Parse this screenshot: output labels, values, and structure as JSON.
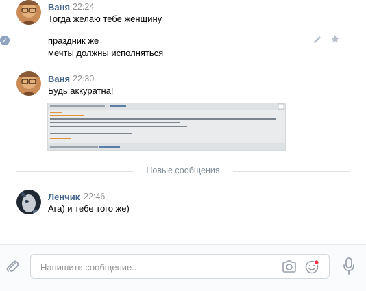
{
  "messages": [
    {
      "author": "Ваня",
      "time": "22:24",
      "lines": [
        "Тогда желаю тебе женщину",
        "праздник же",
        "мечты должны исполняться"
      ]
    },
    {
      "author": "Ваня",
      "time": "22:30",
      "lines": [
        "Будь аккуратна!"
      ]
    },
    {
      "author": "Ленчик",
      "time": "22:46",
      "lines": [
        "Ага) и тебе того же)"
      ]
    }
  ],
  "divider": {
    "label": "Новые сообщения"
  },
  "composer": {
    "placeholder": "Напишите сообщение..."
  },
  "icons": {
    "read_check": "check-circle-icon",
    "edit": "pencil-icon",
    "favorite": "star-icon",
    "attach": "paperclip-icon",
    "camera": "camera-icon",
    "emoji": "smile-icon",
    "voice": "microphone-icon"
  },
  "colors": {
    "author": "#42648b",
    "time": "#939393",
    "divider_text": "#818c99",
    "accent": "#5181b8",
    "notification_dot": "#ff3347"
  }
}
